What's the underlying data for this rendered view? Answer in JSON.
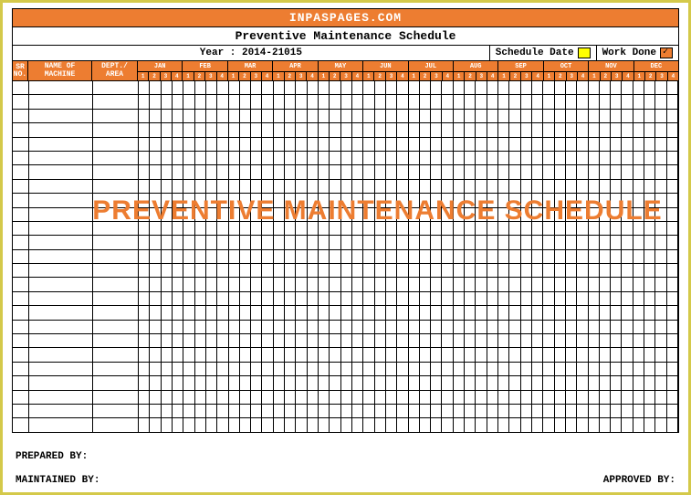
{
  "brand": "INPASPAGES.COM",
  "title": "Preventive Maintenance Schedule",
  "year_label": "Year : 2014-21015",
  "legend": {
    "schedule": "Schedule Date",
    "workdone": "Work Done"
  },
  "colheaders": {
    "sr": "SR NO.",
    "name": "NAME OF MACHINE",
    "dept": "DEPT./ AREA"
  },
  "months": [
    "JAN",
    "FEB",
    "MAR",
    "APR",
    "MAY",
    "JUN",
    "JUL",
    "AUG",
    "SEP",
    "OCT",
    "NOV",
    "DEC"
  ],
  "weeks": [
    "1",
    "2",
    "3",
    "4"
  ],
  "watermark": "PREVENTIVE MAINTENANCE SCHEDULE",
  "footer": {
    "prepared": "PREPARED BY:",
    "maintained": "MAINTAINED BY:",
    "approved": "APPROVED BY:"
  },
  "grid_rows": 25,
  "colors": {
    "accent": "#ed7d31",
    "border": "#d4c94a",
    "schedule_swatch": "#ffff00",
    "workdone_swatch": "#ed7d31"
  }
}
